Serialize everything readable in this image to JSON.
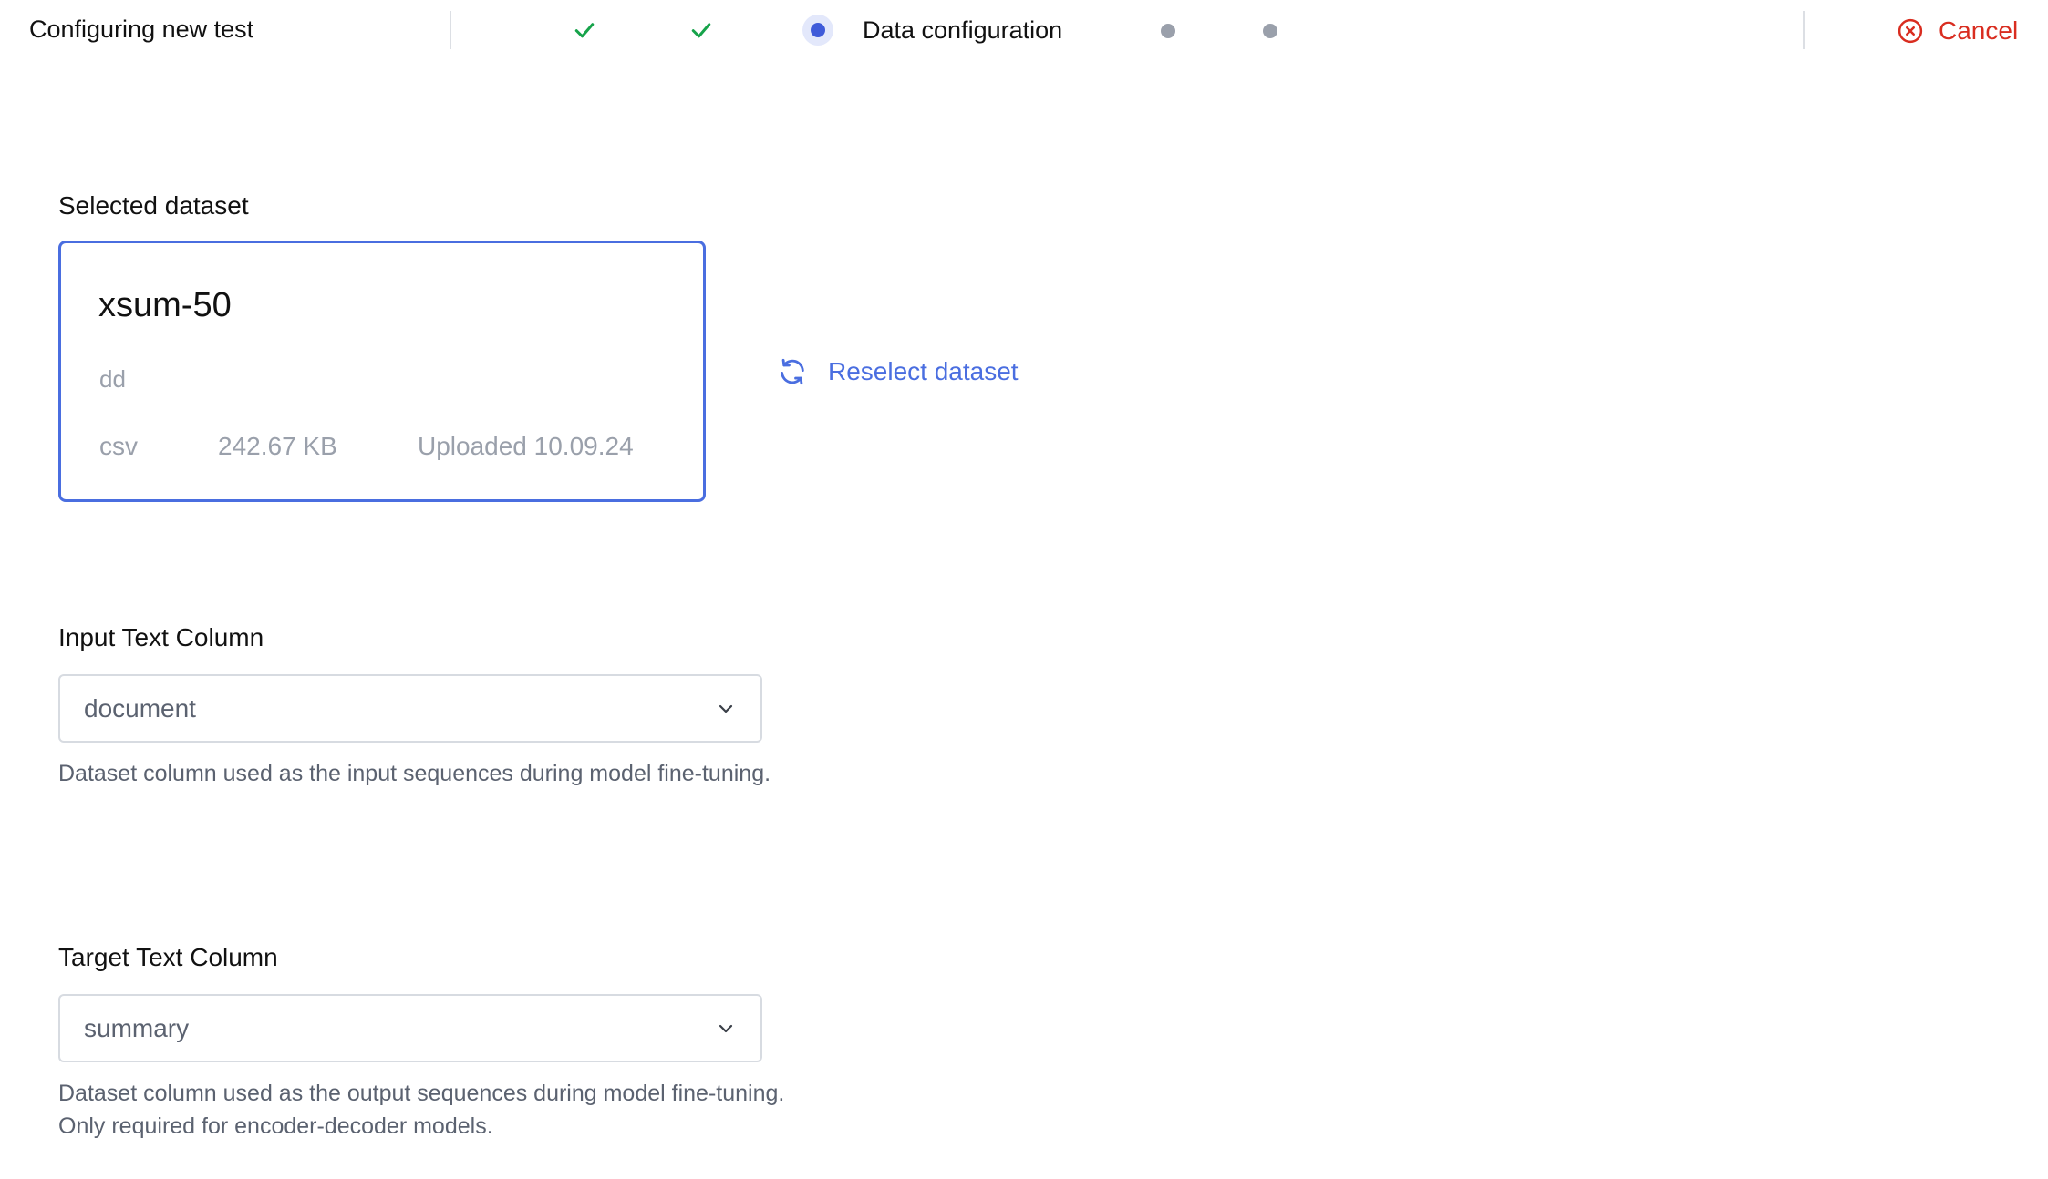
{
  "header": {
    "title": "Configuring new test",
    "steps": [
      {
        "status": "complete",
        "icon": "check-icon"
      },
      {
        "status": "complete",
        "icon": "check-icon"
      },
      {
        "status": "current",
        "label": "Data configuration"
      },
      {
        "status": "upcoming"
      },
      {
        "status": "upcoming"
      }
    ],
    "cancel_label": "Cancel"
  },
  "colors": {
    "accent": "#4a6ee0",
    "step_current": "#3f5bd9",
    "success": "#16a34a",
    "danger": "#d92d20",
    "muted": "#9aa0ab"
  },
  "dataset": {
    "section_label": "Selected dataset",
    "name": "xsum-50",
    "description": "dd",
    "type": "csv",
    "size": "242.67 KB",
    "uploaded": "Uploaded 10.09.24",
    "reselect_label": "Reselect dataset"
  },
  "input_column": {
    "label": "Input Text Column",
    "value": "document",
    "help": "Dataset column used as the input sequences during model fine-tuning."
  },
  "target_column": {
    "label": "Target Text Column",
    "value": "summary",
    "help": "Dataset column used as the output sequences during model fine-tuning. Only required for encoder-decoder models."
  }
}
